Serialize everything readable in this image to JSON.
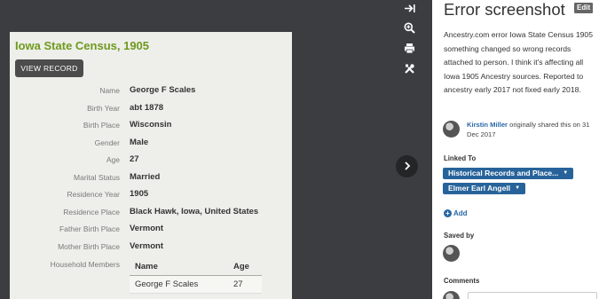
{
  "record": {
    "title": "Iowa State Census, 1905",
    "view_button": "VIEW RECORD",
    "fields": [
      {
        "label": "Name",
        "value": "George F Scales"
      },
      {
        "label": "Birth Year",
        "value": "abt 1878"
      },
      {
        "label": "Birth Place",
        "value": "Wisconsin"
      },
      {
        "label": "Gender",
        "value": "Male"
      },
      {
        "label": "Age",
        "value": "27"
      },
      {
        "label": "Marital Status",
        "value": "Married"
      },
      {
        "label": "Residence Year",
        "value": "1905"
      },
      {
        "label": "Residence Place",
        "value": "Black Hawk, Iowa, United States"
      },
      {
        "label": "Father Birth Place",
        "value": "Vermont"
      },
      {
        "label": "Mother Birth Place",
        "value": "Vermont"
      }
    ],
    "household": {
      "label": "Household Members",
      "columns": [
        "Name",
        "Age"
      ],
      "rows": [
        {
          "name": "George F Scales",
          "age": "27"
        }
      ]
    }
  },
  "toolbar": {
    "icons": [
      "collapse-right-icon",
      "zoom-in-icon",
      "print-icon",
      "tools-icon",
      "chevron-right-icon"
    ]
  },
  "panel": {
    "title": "Error screenshot",
    "edit_label": "Edit",
    "description": "Ancestry.com error Iowa State Census 1905 something changed so wrong records attached to person. I think it's affecting all Iowa 1905 Ancestry sources. Reported to ancestry early 2017 not fixed early 2018.",
    "shared_author": "Kirstin Miller",
    "shared_text": " originally shared this on 31 Dec 2017",
    "linked_to_label": "Linked To",
    "linked_items": [
      "Historical Records and Place...",
      "Elmer Earl Angell"
    ],
    "add_label": "Add",
    "saved_by_label": "Saved by",
    "comments_label": "Comments"
  },
  "colors": {
    "title_green": "#6f9a1e",
    "link_blue": "#2767a6",
    "tag_blue": "#27639a",
    "viewer_bg": "#3b3d40"
  }
}
